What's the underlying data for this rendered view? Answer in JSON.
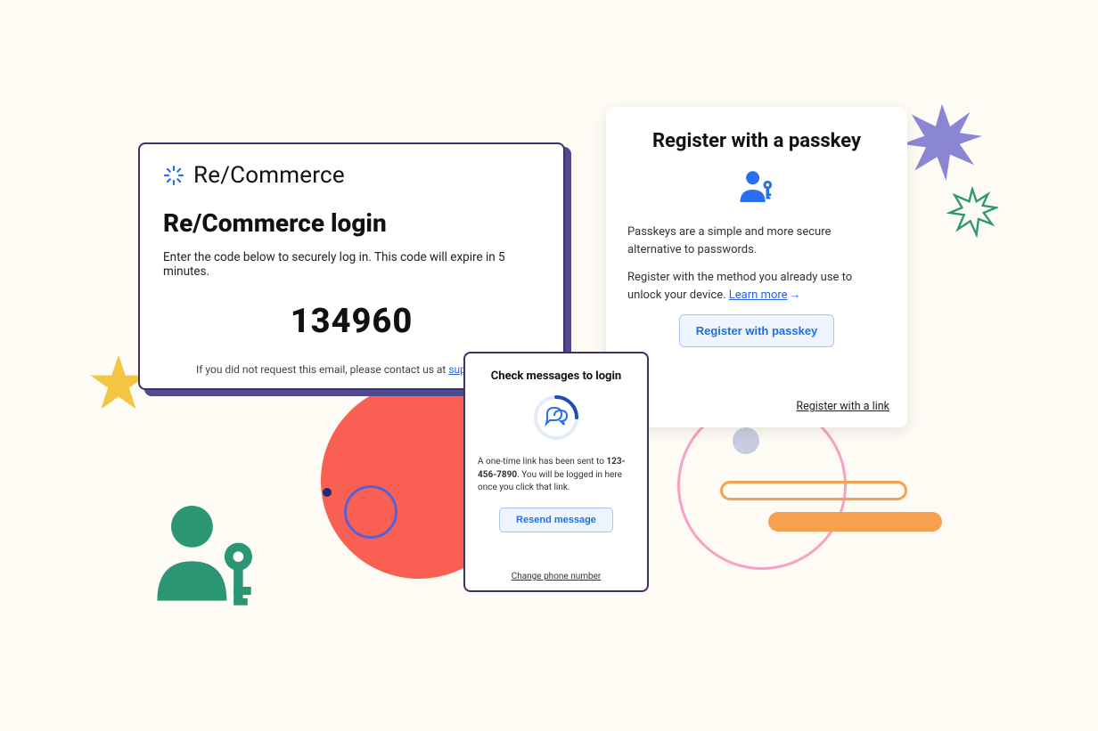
{
  "card1": {
    "brand": "Re/Commerce",
    "title": "Re/Commerce login",
    "subtitle": "Enter the code below to securely log in. This code will expire in 5 minutes.",
    "code": "134960",
    "footer_prefix": "If you did not request this email, please contact us at ",
    "footer_email": "support@re."
  },
  "card2": {
    "title": "Check messages to login",
    "body_prefix": "A one-time link has been sent to ",
    "phone": "123-456-7890",
    "body_suffix": ". You will be logged in here once you click that link.",
    "resend_label": "Resend message",
    "change_label": "Change phone number"
  },
  "card3": {
    "title": "Register with a passkey",
    "p1": "Passkeys are a simple and more secure alternative to passwords.",
    "p2_prefix": "Register with the method you already use to unlock your device. ",
    "learn_more": "Learn more",
    "button_label": "Register with passkey",
    "alt_link": "Register with a link"
  },
  "colors": {
    "accent_blue": "#2a6ff0",
    "card_border": "#3b3268",
    "red": "#f95f53",
    "green": "#2a9674",
    "orange": "#f5a14d",
    "purple": "#8b86d4"
  }
}
